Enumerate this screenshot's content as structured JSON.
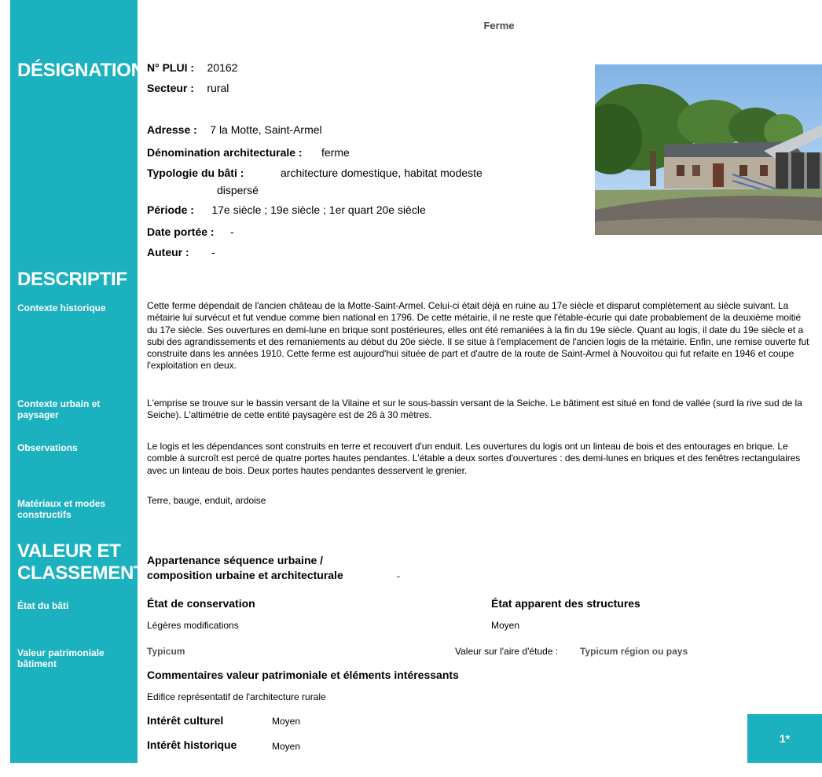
{
  "title": "Ferme",
  "sections": {
    "designation": "DÉSIGNATION",
    "descriptif": "DESCRIPTIF",
    "valeur_line1": "VALEUR ET",
    "valeur_line2": "CLASSEMENT"
  },
  "designation": {
    "plui_label": "N° PLUI :",
    "plui_value": "20162",
    "secteur_label": "Secteur :",
    "secteur_value": "rural",
    "adresse_label": "Adresse :",
    "adresse_value": "7 la Motte, Saint-Armel",
    "denomination_label": "Dénomination architecturale :",
    "denomination_value": "ferme",
    "typologie_label": "Typologie du bâti :",
    "typologie_value_line1": "architecture domestique, habitat modeste",
    "typologie_value_line2": "dispersé",
    "periode_label": "Période :",
    "periode_value": "17e siècle ; 19e siècle ; 1er quart 20e siècle",
    "date_label": "Date portée :",
    "date_value": "-",
    "auteur_label": "Auteur :",
    "auteur_value": "-"
  },
  "descriptif": {
    "contexte_historique_label": "Contexte historique",
    "contexte_historique_text": "Cette ferme dépendait de l'ancien château de la Motte-Saint-Armel. Celui-ci était déjà en ruine au 17e siècle et disparut complètement au siècle suivant. La métairie lui survécut et fut vendue comme bien national en 1796. De cette métairie, il ne reste que l'étable-écurie qui date probablement de la deuxième moitié du 17e siècle. Ses ouvertures en demi-lune en brique sont postérieures, elles ont été remaniées à la fin du 19e siècle. Quant au logis, il date du 19e siècle et a subi des agrandissements et des remaniements au début du 20e siècle. Il se situe à l'emplacement de l'ancien logis de la métairie. Enfin, une remise ouverte fut construite dans les années 1910. Cette ferme est aujourd'hui située de part et d'autre de la route de Saint-Armel à Nouvoitou qui fut refaite en 1946 et coupe l'exploitation en deux.",
    "contexte_urbain_label": "Contexte urbain et paysager",
    "contexte_urbain_text": "L'emprise se trouve sur le bassin versant de la Vilaine et sur le sous-bassin versant de la Seiche. Le bâtiment est situé en fond de vallée (surd la rive sud de la Seiche). L'altimétrie de cette entité paysagère est de 26 à 30 mètres.",
    "observations_label": "Observations",
    "observations_text": "Le logis et les dépendances sont construits en terre et recouvert d'un enduit. Les ouvertures du logis ont un linteau de bois et des entourages en brique. Le comble à surcroît est percé de quatre portes hautes pendantes. L'étable a deux sortes d'ouvertures : des demi-lunes en briques et des fenêtres rectangulaires avec un linteau de bois. Deux portes hautes pendantes desservent le grenier.",
    "materiaux_label": "Matériaux et modes constructifs",
    "materiaux_text": "Terre, bauge, enduit, ardoise"
  },
  "valeur": {
    "appartenance_line1": "Appartenance séquence urbaine /",
    "appartenance_line2": "composition urbaine et architecturale",
    "appartenance_value": "-",
    "etat_bati_label": "État du bâti",
    "conservation_label": "État de conservation",
    "conservation_value": "Légères modifications",
    "structures_label": "État apparent des structures",
    "structures_value": "Moyen",
    "valeur_patrimoniale_label": "Valeur patrimoniale bâtiment",
    "typicum": "Typicum",
    "aire_label": "Valeur sur l'aire d'étude :",
    "aire_value": "Typicum région ou pays",
    "commentaires_label": "Commentaires valeur patrimoniale et éléments intéressants",
    "commentaires_value": "Edifice représentatif de l'architecture rurale",
    "interet_culturel_label": "Intérêt culturel",
    "interet_culturel_value": "Moyen",
    "interet_historique_label": "Intérêt historique",
    "interet_historique_value": "Moyen",
    "badge": "1*"
  },
  "colors": {
    "accent": "#1cb1bf"
  }
}
